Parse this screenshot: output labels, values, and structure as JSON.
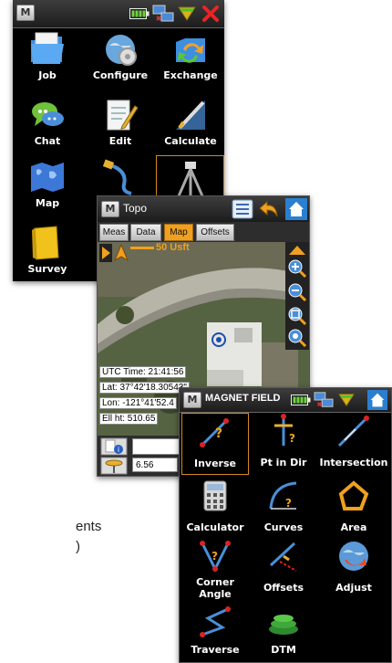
{
  "main_menu": {
    "menu_button_label": "M",
    "tiles": [
      "Job",
      "Configure",
      "Exchange",
      "Chat",
      "Edit",
      "Calculate",
      "Map",
      "Survey"
    ]
  },
  "topo": {
    "menu_button_label": "M",
    "title": "Topo",
    "tabs": [
      "Meas",
      "Data",
      "Map",
      "Offsets"
    ],
    "active_tab": "Map",
    "scale_label": "50 Usft",
    "status": {
      "utc": "UTC Time: 21:41:56",
      "lat": "Lat: 37°42'18.30543\"",
      "lon": "Lon: -121°41'52.4",
      "ell": "Ell ht: 510.65"
    },
    "height_value": "6.56"
  },
  "field": {
    "menu_button_label": "M",
    "title": "MAGNET FIELD",
    "tiles": [
      "Inverse",
      "Pt in Dir",
      "Intersection",
      "Calculator",
      "Curves",
      "Area",
      "Corner Angle",
      "Offsets",
      "Adjust",
      "Traverse",
      "DTM"
    ],
    "selected": "Inverse"
  },
  "background_text": {
    "line1": "ents",
    "line2": ")"
  },
  "colors": {
    "accent_orange": "#d4881d",
    "screen_bg": "#000000",
    "topo_bg": "#ececec",
    "home_blue": "#2a7fd0"
  }
}
